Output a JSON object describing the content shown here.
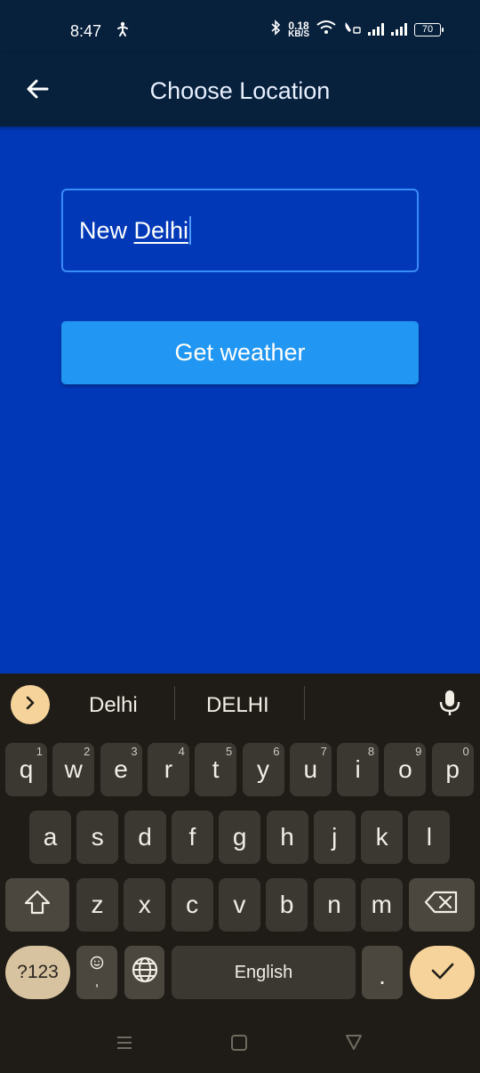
{
  "status_bar": {
    "time": "8:47",
    "net_speed_value": "0.18",
    "net_speed_unit": "KB/S",
    "battery": "70"
  },
  "app_bar": {
    "title": "Choose Location",
    "back_icon": "arrow-left-icon"
  },
  "form": {
    "city_input_value_plain": "New ",
    "city_input_value_underlined": "Delhi",
    "submit_label": "Get weather"
  },
  "keyboard": {
    "suggestions": [
      "Delhi",
      "DELHI"
    ],
    "row1": [
      {
        "k": "q",
        "h": "1"
      },
      {
        "k": "w",
        "h": "2"
      },
      {
        "k": "e",
        "h": "3"
      },
      {
        "k": "r",
        "h": "4"
      },
      {
        "k": "t",
        "h": "5"
      },
      {
        "k": "y",
        "h": "6"
      },
      {
        "k": "u",
        "h": "7"
      },
      {
        "k": "i",
        "h": "8"
      },
      {
        "k": "o",
        "h": "9"
      },
      {
        "k": "p",
        "h": "0"
      }
    ],
    "row2": [
      "a",
      "s",
      "d",
      "f",
      "g",
      "h",
      "j",
      "k",
      "l"
    ],
    "row3": [
      "z",
      "x",
      "c",
      "v",
      "b",
      "n",
      "m"
    ],
    "symbols_label": "?123",
    "comma_label": ",",
    "space_label": "English",
    "period_label": ".",
    "colors": {
      "background": "#1f1c17",
      "key": "#3b3832",
      "accent": "#f6d39a"
    }
  },
  "colors": {
    "app_background": "#0038b8",
    "app_bar": "#07203c",
    "button": "#2196f3",
    "input_border": "#3b8df6"
  }
}
